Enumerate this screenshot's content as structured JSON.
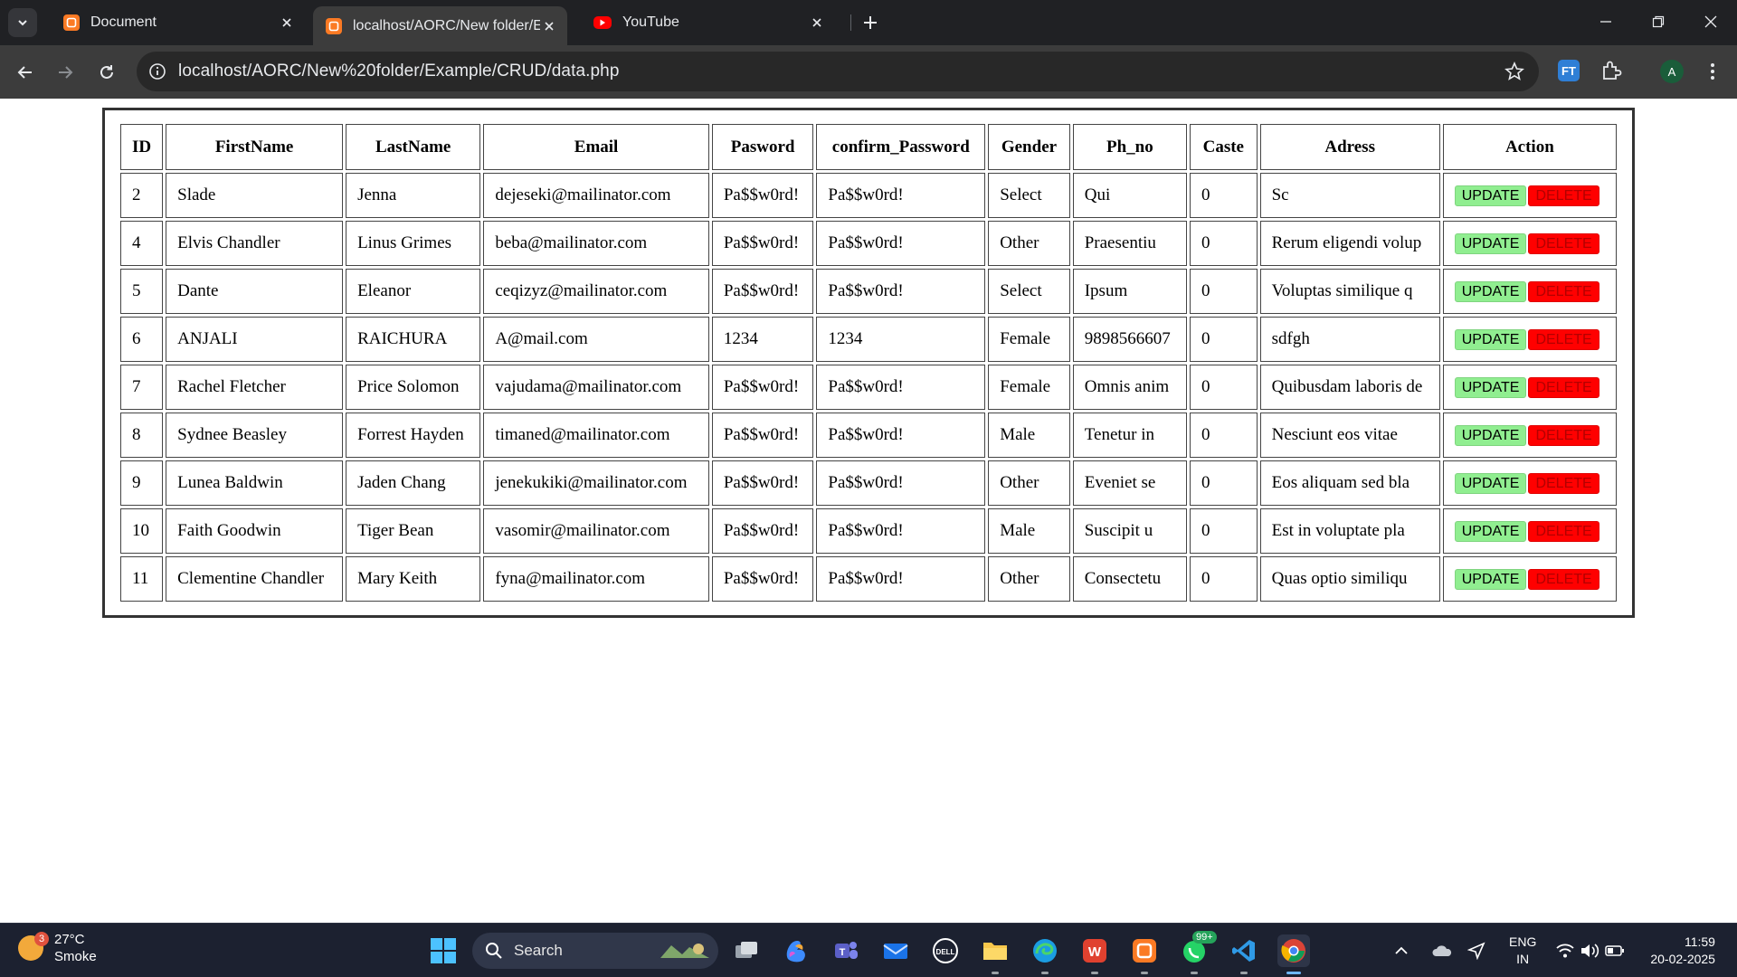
{
  "browser": {
    "tabs": [
      {
        "title": "Document",
        "favicon": "xampp-icon",
        "active": false
      },
      {
        "title": "localhost/AORC/New folder/Exa",
        "favicon": "xampp-icon",
        "active": true
      },
      {
        "title": "YouTube",
        "favicon": "youtube-icon",
        "active": false
      }
    ],
    "url": "localhost/AORC/New%20folder/Example/CRUD/data.php",
    "extension_label": "FT",
    "profile_initial": "A"
  },
  "table": {
    "headers": [
      "ID",
      "FirstName",
      "LastName",
      "Email",
      "Pasword",
      "confirm_Password",
      "Gender",
      "Ph_no",
      "Caste",
      "Adress",
      "Action"
    ],
    "rows": [
      {
        "id": "2",
        "first": "Slade",
        "last": "Jenna",
        "email": "dejeseki@mailinator.com",
        "password": "Pa$$w0rd!",
        "confirm": "Pa$$w0rd!",
        "gender": "Select",
        "phone": "Qui",
        "caste": "0",
        "address": "Sc"
      },
      {
        "id": "4",
        "first": "Elvis Chandler",
        "last": "Linus Grimes",
        "email": "beba@mailinator.com",
        "password": "Pa$$w0rd!",
        "confirm": "Pa$$w0rd!",
        "gender": "Other",
        "phone": "Praesentiu",
        "caste": "0",
        "address": "Rerum eligendi volup"
      },
      {
        "id": "5",
        "first": "Dante",
        "last": "Eleanor",
        "email": "ceqizyz@mailinator.com",
        "password": "Pa$$w0rd!",
        "confirm": "Pa$$w0rd!",
        "gender": "Select",
        "phone": "Ipsum",
        "caste": "0",
        "address": "Voluptas similique q"
      },
      {
        "id": "6",
        "first": "ANJALI",
        "last": "RAICHURA",
        "email": "A@mail.com",
        "password": "1234",
        "confirm": "1234",
        "gender": "Female",
        "phone": "9898566607",
        "caste": "0",
        "address": "sdfgh"
      },
      {
        "id": "7",
        "first": "Rachel Fletcher",
        "last": "Price Solomon",
        "email": "vajudama@mailinator.com",
        "password": "Pa$$w0rd!",
        "confirm": "Pa$$w0rd!",
        "gender": "Female",
        "phone": "Omnis anim",
        "caste": "0",
        "address": "Quibusdam laboris de"
      },
      {
        "id": "8",
        "first": "Sydnee Beasley",
        "last": "Forrest Hayden",
        "email": "timaned@mailinator.com",
        "password": "Pa$$w0rd!",
        "confirm": "Pa$$w0rd!",
        "gender": "Male",
        "phone": "Tenetur in",
        "caste": "0",
        "address": "Nesciunt eos vitae"
      },
      {
        "id": "9",
        "first": "Lunea Baldwin",
        "last": "Jaden Chang",
        "email": "jenekukiki@mailinator.com",
        "password": "Pa$$w0rd!",
        "confirm": "Pa$$w0rd!",
        "gender": "Other",
        "phone": "Eveniet se",
        "caste": "0",
        "address": "Eos aliquam sed bla"
      },
      {
        "id": "10",
        "first": "Faith Goodwin",
        "last": "Tiger Bean",
        "email": "vasomir@mailinator.com",
        "password": "Pa$$w0rd!",
        "confirm": "Pa$$w0rd!",
        "gender": "Male",
        "phone": "Suscipit u",
        "caste": "0",
        "address": "Est in voluptate pla"
      },
      {
        "id": "11",
        "first": "Clementine Chandler",
        "last": "Mary Keith",
        "email": "fyna@mailinator.com",
        "password": "Pa$$w0rd!",
        "confirm": "Pa$$w0rd!",
        "gender": "Other",
        "phone": "Consectetu",
        "caste": "0",
        "address": "Quas optio similiqu"
      }
    ],
    "update_label": "UPDATE",
    "delete_label": "DELETE"
  },
  "taskbar": {
    "weather_temp": "27°C",
    "weather_desc": "Smoke",
    "weather_badge": "3",
    "search_label": "Search",
    "whatsapp_badge": "99+",
    "lang_top": "ENG",
    "lang_bottom": "IN",
    "time": "11:59",
    "date": "20-02-2025"
  },
  "colors": {
    "update_button": "#90ee90",
    "delete_button": "#ff0000",
    "browser_frame": "#202124",
    "taskbar": "#1c2130"
  }
}
